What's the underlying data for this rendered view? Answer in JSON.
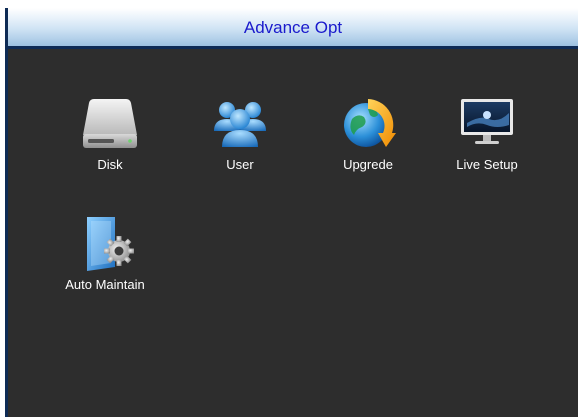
{
  "window": {
    "title": "Advance Opt"
  },
  "menu": {
    "items": [
      {
        "label": "Disk",
        "icon": "disk-icon"
      },
      {
        "label": "User",
        "icon": "users-icon"
      },
      {
        "label": "Upgrede",
        "icon": "upgrade-globe-icon"
      },
      {
        "label": "Live Setup",
        "icon": "monitor-icon"
      },
      {
        "label": "Auto Maintain",
        "icon": "auto-maintain-icon"
      }
    ]
  },
  "colors": {
    "background": "#2d2d2d",
    "title_text": "#1a1acc",
    "label_text": "#ffffff",
    "frame": "#0e2b55"
  }
}
